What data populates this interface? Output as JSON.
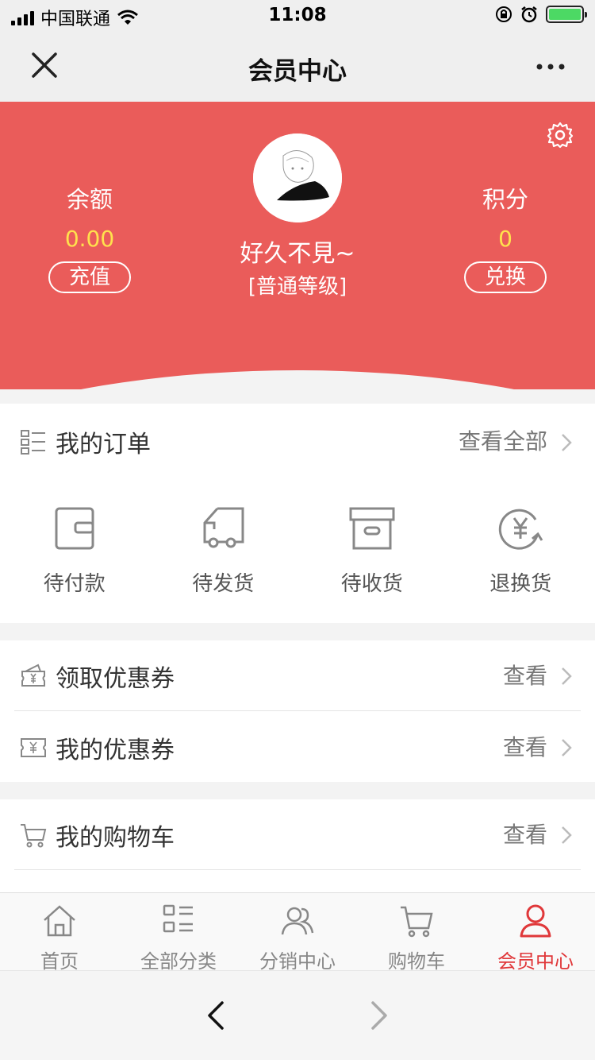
{
  "status_bar": {
    "carrier": "中国联通",
    "time": "11:08"
  },
  "nav": {
    "title": "会员中心",
    "close_icon": "close-icon",
    "more_icon": "more-icon"
  },
  "profile": {
    "balance_label": "余额",
    "balance_value": "0.00",
    "recharge_label": "充值",
    "points_label": "积分",
    "points_value": "0",
    "exchange_label": "兑换",
    "username": "好久不見~",
    "level": "[普通等级]",
    "accent_color": "#ea5c5a",
    "value_color": "#ffe14d"
  },
  "orders": {
    "title": "我的订单",
    "view_all": "查看全部",
    "items": [
      {
        "label": "待付款",
        "icon": "wallet-icon"
      },
      {
        "label": "待发货",
        "icon": "truck-icon"
      },
      {
        "label": "待收货",
        "icon": "box-icon"
      },
      {
        "label": "退换货",
        "icon": "yuan-refund-icon"
      }
    ]
  },
  "coupons": {
    "get_title": "领取优惠券",
    "get_more": "查看",
    "my_title": "我的优惠券",
    "my_more": "查看"
  },
  "cart": {
    "title": "我的购物车",
    "more": "查看"
  },
  "tabs": [
    {
      "label": "首页",
      "icon": "home-icon",
      "active": false
    },
    {
      "label": "全部分类",
      "icon": "category-icon",
      "active": false
    },
    {
      "label": "分销中心",
      "icon": "users-icon",
      "active": false
    },
    {
      "label": "购物车",
      "icon": "cart-icon",
      "active": false
    },
    {
      "label": "会员中心",
      "icon": "user-icon",
      "active": true
    }
  ],
  "active_color": "#e0383a"
}
